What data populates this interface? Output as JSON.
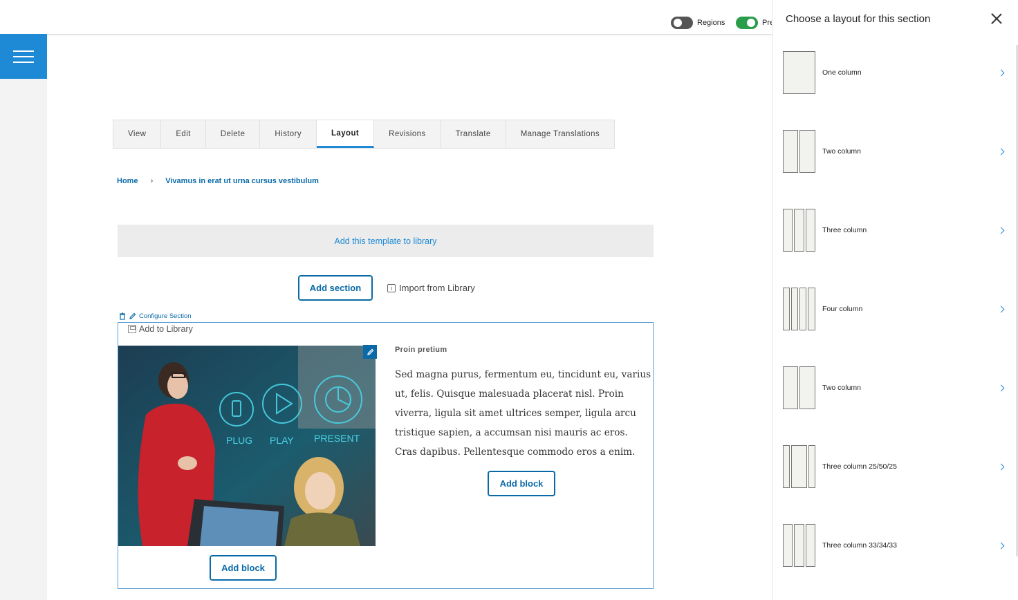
{
  "topbar": {
    "regions_label": "Regions",
    "preview_label": "Pre"
  },
  "tabs": [
    {
      "label": "View"
    },
    {
      "label": "Edit"
    },
    {
      "label": "Delete"
    },
    {
      "label": "History"
    },
    {
      "label": "Layout",
      "active": true
    },
    {
      "label": "Revisions"
    },
    {
      "label": "Translate"
    },
    {
      "label": "Manage Translations"
    }
  ],
  "breadcrumb": {
    "home": "Home",
    "current": "Vivamus in erat ut urna cursus vestibulum"
  },
  "template_bar": {
    "label": "Add this template to library"
  },
  "actions": {
    "add_section": "Add section",
    "import_library": "Import from Library"
  },
  "section": {
    "configure_label": "Configure Section",
    "add_library_label": "Add to Library",
    "image_labels": [
      "PLUG",
      "PLAY",
      "PRESENT"
    ],
    "block_title": "Proin pretium",
    "block_body": "Sed magna purus, fermentum eu, tincidunt eu, varius ut, felis. Quisque malesuada placerat nisl. Proin viverra, ligula sit amet ultrices semper, ligula arcu tristique sapien, a accumsan nisi mauris ac eros. Cras dapibus. Pellentesque commodo eros a enim.",
    "add_block_right": "Add block",
    "add_block_left": "Add block"
  },
  "panel": {
    "title": "Choose a layout for this section",
    "layouts": [
      {
        "label": "One column"
      },
      {
        "label": "Two column"
      },
      {
        "label": "Three column"
      },
      {
        "label": "Four column"
      },
      {
        "label": "Two column"
      },
      {
        "label": "Three column 25/50/25"
      },
      {
        "label": "Three column 33/34/33"
      }
    ]
  },
  "colors": {
    "accent": "#1e8ad6",
    "link": "#0a6aa8",
    "toggle_on": "#2a9d4b"
  }
}
